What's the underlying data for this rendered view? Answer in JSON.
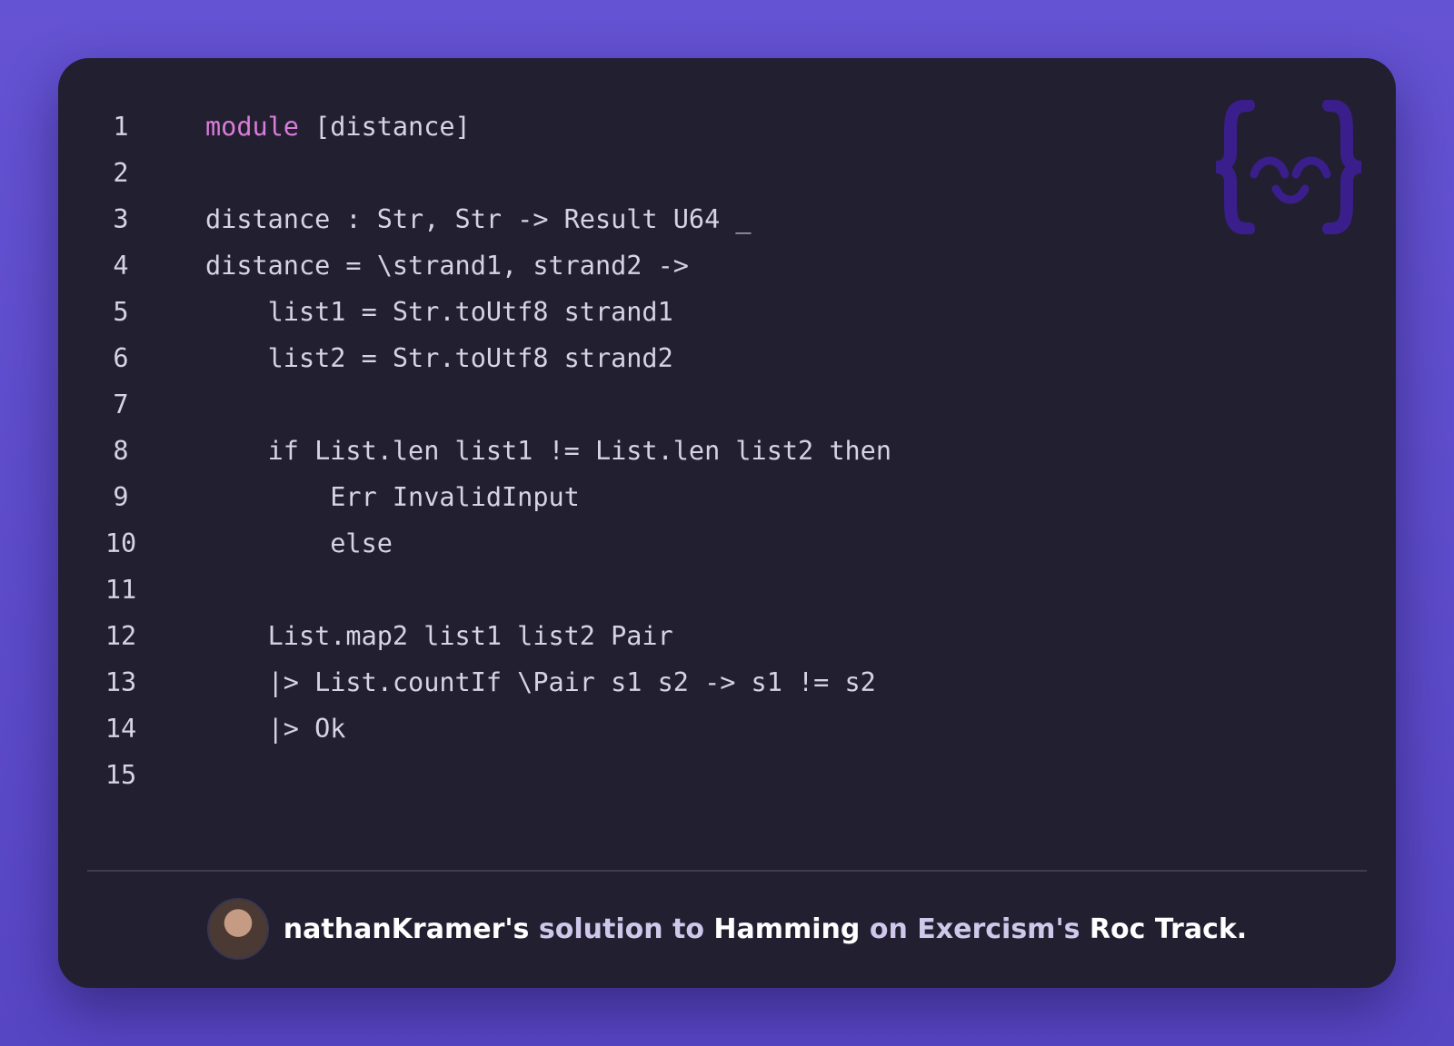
{
  "code_lines": [
    {
      "num": "1",
      "keyword": "module",
      "text": " [distance]"
    },
    {
      "num": "2",
      "keyword": "",
      "text": ""
    },
    {
      "num": "3",
      "keyword": "",
      "text": "distance : Str, Str -> Result U64 _"
    },
    {
      "num": "4",
      "keyword": "",
      "text": "distance = \\strand1, strand2 ->"
    },
    {
      "num": "5",
      "keyword": "",
      "text": "    list1 = Str.toUtf8 strand1"
    },
    {
      "num": "6",
      "keyword": "",
      "text": "    list2 = Str.toUtf8 strand2"
    },
    {
      "num": "7",
      "keyword": "",
      "text": ""
    },
    {
      "num": "8",
      "keyword": "",
      "text": "    if List.len list1 != List.len list2 then"
    },
    {
      "num": "9",
      "keyword": "",
      "text": "        Err InvalidInput"
    },
    {
      "num": "10",
      "keyword": "",
      "text": "        else"
    },
    {
      "num": "11",
      "keyword": "",
      "text": ""
    },
    {
      "num": "12",
      "keyword": "",
      "text": "    List.map2 list1 list2 Pair"
    },
    {
      "num": "13",
      "keyword": "",
      "text": "    |> List.countIf \\Pair s1 s2 -> s1 != s2"
    },
    {
      "num": "14",
      "keyword": "",
      "text": "    |> Ok"
    },
    {
      "num": "15",
      "keyword": "",
      "text": ""
    }
  ],
  "footer": {
    "author": "nathanKramer",
    "possessive_1": "'s",
    "solution_to": " solution to ",
    "exercise": "Hamming",
    "on": " on ",
    "site": "Exercism",
    "possessive_2": "'s",
    "track": " Roc Track."
  },
  "icons": {
    "logo": "exercism-logo-icon",
    "avatar": "author-avatar"
  },
  "colors": {
    "background": "#5e4dce",
    "card": "#221f30",
    "keyword": "#d97dd6",
    "text": "#d6d3e4",
    "logo": "#3b1f8f"
  }
}
